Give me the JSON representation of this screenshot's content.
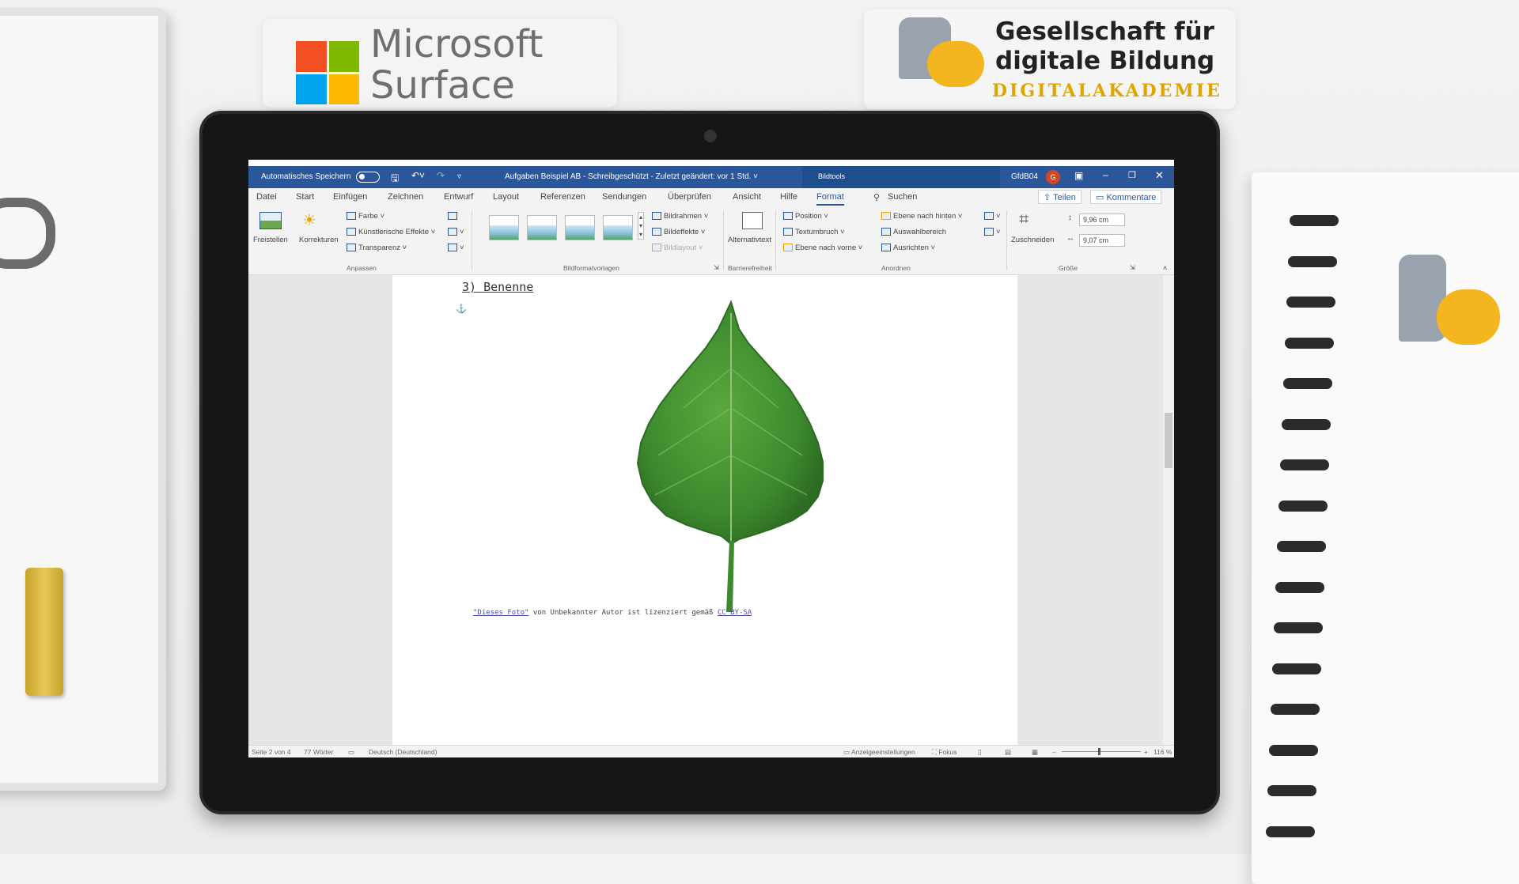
{
  "branding": {
    "ms_line1": "Microsoft",
    "ms_line2": "Surface",
    "gdb_line1": "Gesellschaft für",
    "gdb_line2": "digitale Bildung",
    "gdb_sub": "DIGITALAKADEMIE"
  },
  "titlebar": {
    "autosave_label": "Automatisches Speichern",
    "doc_title": "Aufgaben Beispiel AB  -  Schreibgeschützt  -  Zuletzt geändert: vor 1 Std. ˅",
    "context_tools": "Bildtools",
    "user": "GfdB04",
    "avatar_initial": "G"
  },
  "tabs": [
    "Datei",
    "Start",
    "Einfügen",
    "Zeichnen",
    "Entwurf",
    "Layout",
    "Referenzen",
    "Sendungen",
    "Überprüfen",
    "Ansicht",
    "Hilfe",
    "Format"
  ],
  "active_tab": "Format",
  "search_label": "Suchen",
  "share_label": "Teilen",
  "comments_label": "Kommentare",
  "ribbon": {
    "freistellen": "Freistellen",
    "korrekturen": "Korrekturen",
    "farbe": "Farbe ˅",
    "kuenstlerische": "Künstlerische Effekte ˅",
    "transparenz": "Transparenz ˅",
    "group_anpassen": "Anpassen",
    "bildrahmen": "Bildrahmen ˅",
    "bildeffekte": "Bildeffekte ˅",
    "bildlayout": "Bildlayout ˅",
    "group_bildformat": "Bildformatvorlagen",
    "alternativtext": "Alternativtext",
    "group_barriere": "Barrierefreiheit",
    "position": "Position ˅",
    "textumbruch": "Textumbruch ˅",
    "ebene_vorne": "Ebene nach vorne ˅",
    "ebene_hinten": "Ebene nach hinten ˅",
    "auswahlbereich": "Auswahlbereich",
    "ausrichten": "Ausrichten ˅",
    "group_anordnen": "Anordnen",
    "zuschneiden": "Zuschneiden",
    "height": "9,96 cm",
    "width": "9,07 cm",
    "group_groesse": "Größe"
  },
  "document": {
    "heading": "3) Benenne",
    "caption_prefix": "\"Dieses Foto\"",
    "caption_mid": " von Unbekannter Autor ist lizenziert gemäß ",
    "caption_license": "CC BY-SA"
  },
  "statusbar": {
    "page": "Seite 2 von 4",
    "words": "77 Wörter",
    "language": "Deutsch (Deutschland)",
    "display_settings": "Anzeigeeinstellungen",
    "focus": "Fokus",
    "zoom": "116 %"
  },
  "colors": {
    "word_blue": "#2b579a",
    "leaf_green": "#3d8a2e"
  }
}
